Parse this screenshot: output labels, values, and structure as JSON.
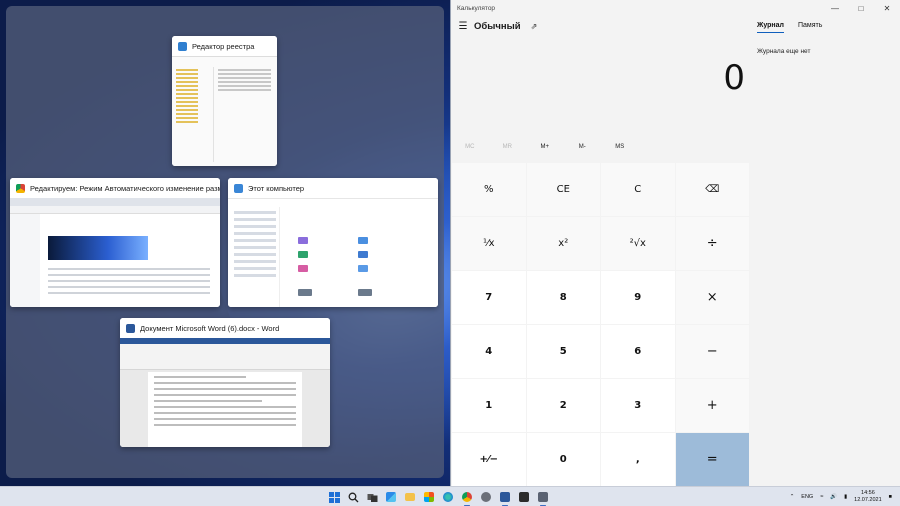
{
  "snap": {
    "windows": [
      {
        "title": "Редактор реестра"
      },
      {
        "title": "Редактируем: Режим Автоматического изменение размера и ра..."
      },
      {
        "title": "Этот компьютер"
      },
      {
        "title": "Документ Microsoft Word (6).docx - Word"
      }
    ]
  },
  "calculator": {
    "window_title": "Калькулятор",
    "mode": "Обычный",
    "display": "0",
    "memory": [
      "MC",
      "MR",
      "M+",
      "M-",
      "MS"
    ],
    "keys": [
      "%",
      "CE",
      "C",
      "⌫",
      "¹⁄x",
      "x²",
      "²√x",
      "÷",
      "7",
      "8",
      "9",
      "×",
      "4",
      "5",
      "6",
      "−",
      "1",
      "2",
      "3",
      "+",
      "+⁄−",
      "0",
      ",",
      "="
    ],
    "tabs": {
      "journal": "Журнал",
      "memory": "Память"
    },
    "journal_empty": "Журнала еще нет"
  },
  "taskbar": {
    "lang": "ENG",
    "time": "14:56",
    "date": "12.07.2021",
    "icons": [
      "start-icon",
      "search-icon",
      "task-view-icon",
      "widgets-icon",
      "file-explorer-icon",
      "store-icon",
      "edge-icon",
      "chrome-icon",
      "settings-icon",
      "word-icon",
      "terminal-icon",
      "calculator-icon"
    ]
  },
  "colors": {
    "accent": "#9dbbd9",
    "snap_overlay": "#525c78",
    "taskbar": "#dfe4ee"
  }
}
